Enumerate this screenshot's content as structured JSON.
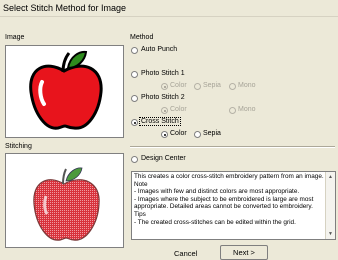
{
  "window": {
    "title": "Select Stitch Method for Image"
  },
  "labels": {
    "image": "Image",
    "stitching": "Stitching",
    "method": "Method"
  },
  "methods": [
    {
      "label": "Auto Punch",
      "selected": false
    },
    {
      "label": "Photo Stitch 1",
      "selected": false,
      "options": [
        "Color",
        "Sepia",
        "Mono"
      ],
      "selected_option": "Color",
      "disabled": true
    },
    {
      "label": "Photo Stitch 2",
      "selected": false,
      "options": [
        "Color",
        "Mono"
      ],
      "selected_option": "Color",
      "disabled": true
    },
    {
      "label": "Cross Stitch",
      "selected": true,
      "options": [
        "Color",
        "Sepia"
      ],
      "selected_option": "Color",
      "disabled": false
    },
    {
      "label": "Design Center",
      "selected": false
    }
  ],
  "description": {
    "lines": [
      "This creates a color cross-stitch embroidery pattern from an image.",
      "Note",
      "- Images with few and distinct colors are most appropriate.",
      "- Images where the subject to be embroidered is large are most appropriate. Detailed areas cannot be converted to embroidery.",
      "Tips",
      "- The created cross-stitches can be edited within the grid."
    ]
  },
  "buttons": {
    "cancel": "Cancel",
    "next": "Next >"
  },
  "colors": {
    "apple_red": "#e8141c",
    "leaf_green": "#2e8b1e",
    "stitch_red": "#d8323c",
    "dialog_bg": "#ece9d8"
  }
}
